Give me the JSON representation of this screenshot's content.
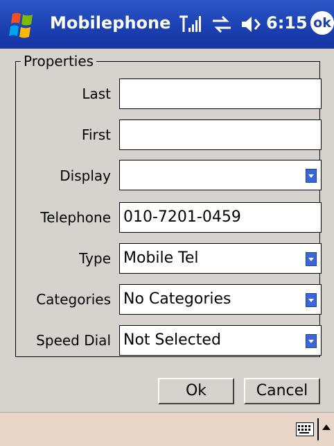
{
  "titlebar": {
    "app_title": "Mobilephone",
    "time": "6:15",
    "ok_label": "ok"
  },
  "form": {
    "group_label": "Properties",
    "fields": [
      {
        "label": "Last",
        "value": "",
        "type": "text"
      },
      {
        "label": "First",
        "value": "",
        "type": "text"
      },
      {
        "label": "Display",
        "value": "",
        "type": "dropdown"
      },
      {
        "label": "Telephone",
        "value": "010-7201-0459",
        "type": "text"
      },
      {
        "label": "Type",
        "value": "Mobile Tel",
        "type": "dropdown"
      },
      {
        "label": "Categories",
        "value": "No Categories",
        "type": "dropdown"
      },
      {
        "label": "Speed Dial",
        "value": "Not Selected",
        "type": "dropdown"
      }
    ]
  },
  "buttons": {
    "ok_label": "Ok",
    "cancel_label": "Cancel"
  },
  "colors": {
    "titlebar": "#1a3fb0",
    "dialog_bg": "#d6d3ce",
    "menubar": "#e8d6c8"
  },
  "icons": [
    "windows-start-icon",
    "signal-icon",
    "sync-icon",
    "volume-icon",
    "keyboard-icon",
    "arrow-up-icon"
  ]
}
